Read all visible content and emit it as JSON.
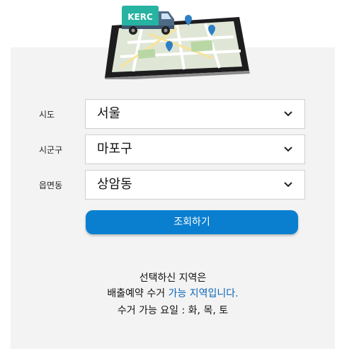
{
  "hero": {
    "truck_label": "KERC"
  },
  "form": {
    "rows": [
      {
        "label": "시도",
        "value": "서울"
      },
      {
        "label": "시군구",
        "value": "마포구"
      },
      {
        "label": "읍면동",
        "value": "상암동"
      }
    ],
    "submit_label": "조회하기"
  },
  "result": {
    "line1": "선택하신 지역은",
    "line2_prefix": "배출예약 수거 ",
    "line2_highlight": "가능 지역입니다.",
    "line3": "수거 가능 요일 : 화, 목, 토"
  },
  "colors": {
    "accent": "#0a7fd0",
    "highlight": "#0a64b8",
    "panel": "#f3f3f3",
    "truck": "#26b3a1"
  }
}
